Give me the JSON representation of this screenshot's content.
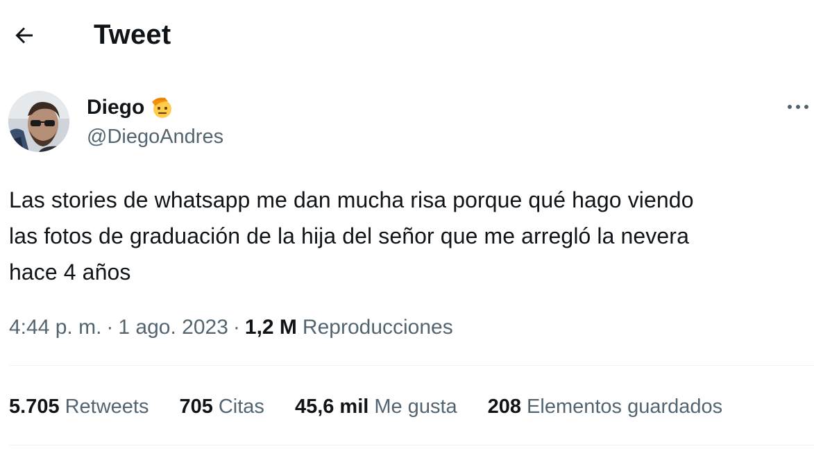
{
  "header": {
    "back_icon": "arrow-left-icon",
    "title": "Tweet"
  },
  "author": {
    "name": "Diego",
    "name_emoji": "saluting-face-emoji",
    "handle": "@DiegoAndres",
    "more_icon": "more-horizontal-icon"
  },
  "tweet": {
    "text_lines": [
      "Las stories de whatsapp me dan mucha risa porque qué hago viendo",
      "las fotos de graduación de la hija del señor que me arregló la nevera",
      "hace 4 años"
    ]
  },
  "meta": {
    "time": "4:44 p. m.",
    "separator": "·",
    "date": "1 ago. 2023",
    "views_count": "1,2 M",
    "views_label": "Reproducciones"
  },
  "stats": [
    {
      "count": "5.705",
      "label": "Retweets"
    },
    {
      "count": "705",
      "label": "Citas"
    },
    {
      "count": "45,6 mil",
      "label": "Me gusta"
    },
    {
      "count": "208",
      "label": "Elementos guardados"
    }
  ],
  "colors": {
    "text_primary": "#0f1419",
    "text_secondary": "#536471",
    "divider": "#eff3f4",
    "emoji_yellow": "#ffcc4d",
    "emoji_orange": "#f4900c"
  }
}
